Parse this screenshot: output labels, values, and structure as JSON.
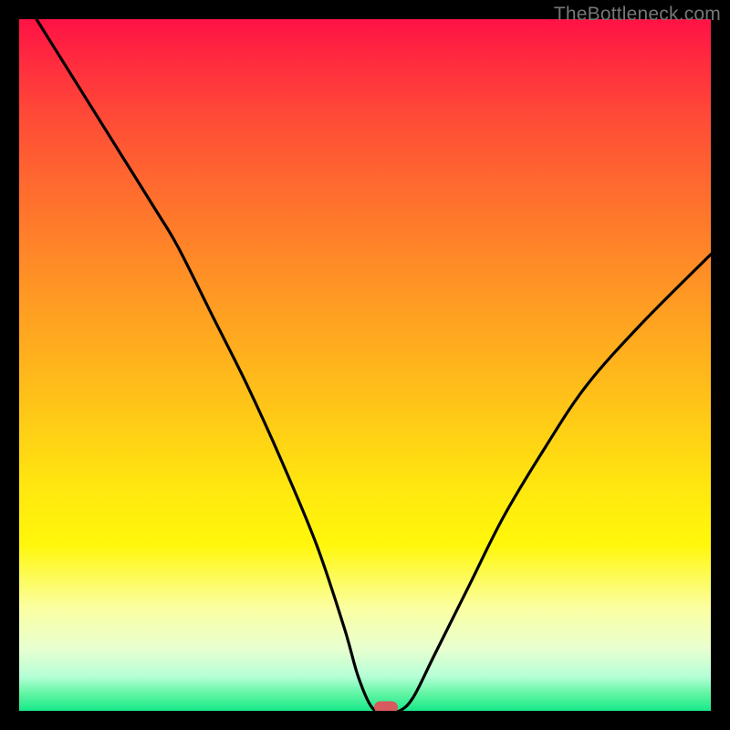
{
  "watermark": "TheBottleneck.com",
  "colors": {
    "background": "#000000",
    "curve": "#000000",
    "marker": "#d65a5e",
    "gradient_top": "#ff1245",
    "gradient_bottom": "#17e989"
  },
  "chart_data": {
    "type": "line",
    "title": "",
    "xlabel": "",
    "ylabel": "",
    "xlim": [
      0,
      100
    ],
    "ylim": [
      0,
      100
    ],
    "grid": false,
    "legend": false,
    "annotations": [
      {
        "type": "marker",
        "x": 53,
        "y": 0,
        "shape": "pill",
        "color": "#d65a5e"
      }
    ],
    "series": [
      {
        "name": "bottleneck-curve",
        "color": "#000000",
        "x": [
          0,
          5,
          10,
          15,
          20,
          23,
          28,
          33,
          38,
          43,
          47,
          49,
          51,
          53,
          55,
          57,
          60,
          65,
          70,
          76,
          82,
          90,
          100
        ],
        "y": [
          104,
          96,
          88,
          80,
          72,
          67,
          57,
          47,
          36,
          24,
          12,
          5,
          0.5,
          0,
          0,
          2,
          8,
          18,
          28,
          38,
          47,
          56,
          66
        ]
      }
    ],
    "note": "V-shaped bottleneck curve over a vertical rainbow gradient; minimum (optimal match) near x≈53. Y values are read as percent of plot height from bottom; no numeric axis ticks are shown in the image, so values are visual estimates."
  }
}
